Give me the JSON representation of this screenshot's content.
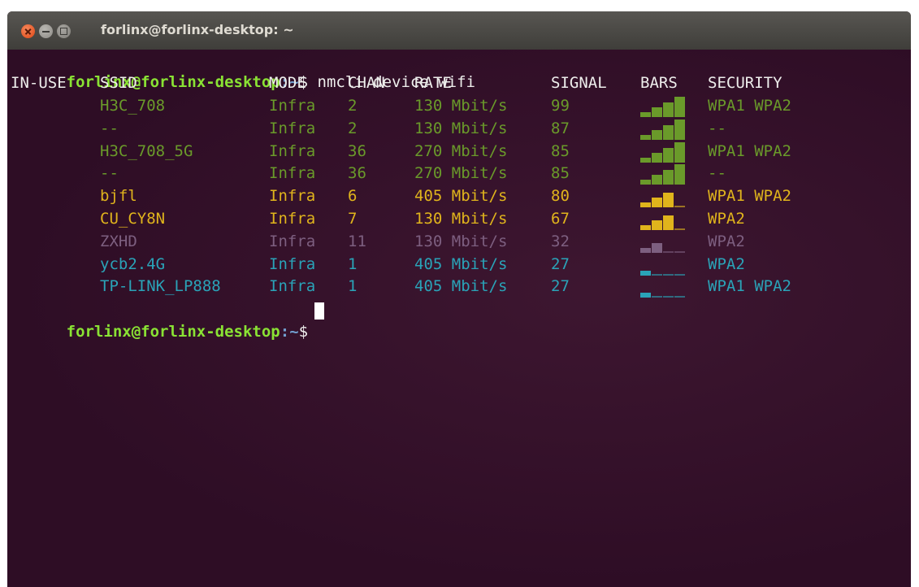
{
  "window": {
    "title": "forlinx@forlinx-desktop: ~"
  },
  "prompt": {
    "user_host": "forlinx@forlinx-desktop",
    "path": ":~",
    "symbol": "$ "
  },
  "command": "nmcli device wifi",
  "headers": {
    "in_use": "IN-USE",
    "ssid": "SSID",
    "mode": "MODE",
    "chan": "CHAN",
    "rate": "RATE",
    "signal": "SIGNAL",
    "bars": "BARS",
    "security": "SECURITY"
  },
  "colors": {
    "green": "#8ae234",
    "green_dim": "#6a9a2a",
    "yellow": "#e0b41c",
    "purple": "#7d5f80",
    "cyan": "#2aa3b8",
    "bars_empty": "#6a4a60"
  },
  "rows": [
    {
      "in_use": "",
      "ssid": "H3C_708",
      "mode": "Infra",
      "chan": "2",
      "rate": "130 Mbit/s",
      "signal": "99",
      "bars_level": 4,
      "security": "WPA1 WPA2",
      "color": "green_dim"
    },
    {
      "in_use": "",
      "ssid": "--",
      "mode": "Infra",
      "chan": "2",
      "rate": "130 Mbit/s",
      "signal": "87",
      "bars_level": 4,
      "security": "--",
      "color": "green_dim"
    },
    {
      "in_use": "",
      "ssid": "H3C_708_5G",
      "mode": "Infra",
      "chan": "36",
      "rate": "270 Mbit/s",
      "signal": "85",
      "bars_level": 4,
      "security": "WPA1 WPA2",
      "color": "green_dim"
    },
    {
      "in_use": "",
      "ssid": "--",
      "mode": "Infra",
      "chan": "36",
      "rate": "270 Mbit/s",
      "signal": "85",
      "bars_level": 4,
      "security": "--",
      "color": "green_dim"
    },
    {
      "in_use": "",
      "ssid": "bjfl",
      "mode": "Infra",
      "chan": "6",
      "rate": "405 Mbit/s",
      "signal": "80",
      "bars_level": 3,
      "security": "WPA1 WPA2",
      "color": "yellow"
    },
    {
      "in_use": "",
      "ssid": "CU_CY8N",
      "mode": "Infra",
      "chan": "7",
      "rate": "130 Mbit/s",
      "signal": "67",
      "bars_level": 3,
      "security": "WPA2",
      "color": "yellow"
    },
    {
      "in_use": "",
      "ssid": "ZXHD",
      "mode": "Infra",
      "chan": "11",
      "rate": "130 Mbit/s",
      "signal": "32",
      "bars_level": 2,
      "security": "WPA2",
      "color": "purple"
    },
    {
      "in_use": "",
      "ssid": "ycb2.4G",
      "mode": "Infra",
      "chan": "1",
      "rate": "405 Mbit/s",
      "signal": "27",
      "bars_level": 1,
      "security": "WPA2",
      "color": "cyan"
    },
    {
      "in_use": "",
      "ssid": "TP-LINK_LP888",
      "mode": "Infra",
      "chan": "1",
      "rate": "405 Mbit/s",
      "signal": "27",
      "bars_level": 1,
      "security": "WPA1 WPA2",
      "color": "cyan"
    }
  ]
}
